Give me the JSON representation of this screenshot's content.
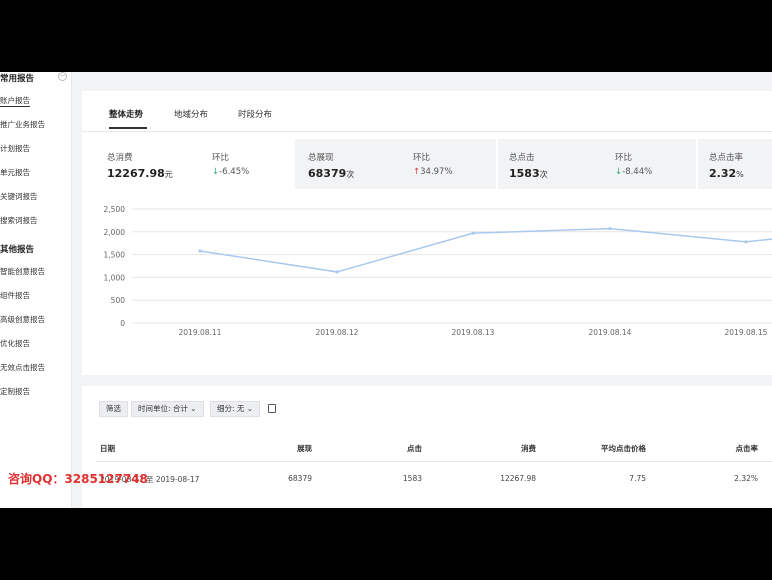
{
  "sidebar": {
    "group1": "常用报告",
    "items1": [
      "账户报告",
      "推广业务报告",
      "计划报告",
      "单元报告",
      "关键词报告",
      "搜索词报告"
    ],
    "group2": "其他报告",
    "items2": [
      "智能创意报告",
      "组件报告",
      "高级创意报告",
      "优化报告",
      "无效点击报告",
      "定制报告"
    ]
  },
  "tabs": [
    "整体走势",
    "地域分布",
    "时段分布"
  ],
  "metrics": [
    {
      "label": "总消费",
      "value": "12267.98",
      "unit": "元",
      "ratio_label": "环比",
      "arrow": "↓",
      "change": "-6.45%"
    },
    {
      "label": "总展现",
      "value": "68379",
      "unit": "次",
      "ratio_label": "环比",
      "arrow": "↑",
      "change": "34.97%"
    },
    {
      "label": "总点击",
      "value": "1583",
      "unit": "次",
      "ratio_label": "环比",
      "arrow": "↓",
      "change": "-8.44%"
    },
    {
      "label": "总点击率",
      "value": "2.32",
      "unit": "%"
    }
  ],
  "colors": {
    "line": "#a9c8ee",
    "grid": "#e6e6e6",
    "down": "#2eaa6e",
    "up": "#e0403a",
    "watermark": "#e03030"
  },
  "chart_data": {
    "type": "line",
    "x": [
      "2019.08.11",
      "2019.08.12",
      "2019.08.13",
      "2019.08.14",
      "2019.08.15"
    ],
    "series": [
      {
        "values": [
          1580,
          1120,
          1970,
          2070,
          1780
        ]
      }
    ],
    "y_ticks": [
      "2,500",
      "2,000",
      "1,500",
      "1,000",
      "500",
      "0"
    ],
    "ylim": [
      0,
      2500
    ],
    "grid": true
  },
  "filters": {
    "filter_label": "筛选",
    "time_unit": "时间单位: 合计",
    "breakdown": "细分: 无"
  },
  "table": {
    "headers": [
      "日期",
      "展现",
      "点击",
      "消费",
      "平均点击价格",
      "点击率"
    ],
    "rows": [
      [
        "2019-08-11 至 2019-08-17",
        "68379",
        "1583",
        "12267.98",
        "7.75",
        "2.32%"
      ]
    ]
  },
  "watermark": "咨询QQ：3285127748"
}
